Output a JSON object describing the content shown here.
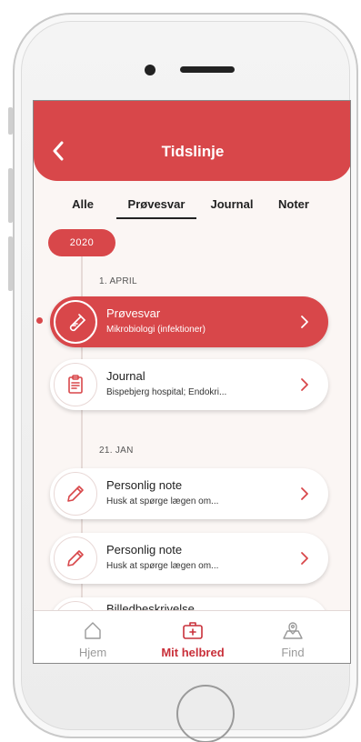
{
  "header": {
    "title": "Tidslinje"
  },
  "tabs": [
    {
      "label": "Alle",
      "active": false
    },
    {
      "label": "Prøvesvar",
      "active": true
    },
    {
      "label": "Journal",
      "active": false
    },
    {
      "label": "Noter",
      "active": false
    }
  ],
  "timeline": {
    "year": "2020",
    "dates": [
      "1. APRIL",
      "21. JAN"
    ],
    "entries": [
      {
        "title": "Prøvesvar",
        "subtitle": "Mikrobiologi (infektioner)",
        "icon": "test-tube-icon",
        "selected": true
      },
      {
        "title": "Journal",
        "subtitle": "Bispebjerg hospital; Endokri...",
        "icon": "clipboard-icon",
        "selected": false
      },
      {
        "title": "Personlig note",
        "subtitle": "Husk at spørge lægen om...",
        "icon": "pencil-icon",
        "selected": false
      },
      {
        "title": "Personlig note",
        "subtitle": "Husk at spørge lægen om...",
        "icon": "pencil-icon",
        "selected": false
      },
      {
        "title": "Billedbeskrivelse",
        "subtitle": "",
        "icon": "image-icon",
        "selected": false
      }
    ]
  },
  "tabbar": [
    {
      "label": "Hjem",
      "icon": "home-icon",
      "active": false
    },
    {
      "label": "Mit helbred",
      "icon": "medical-kit-icon",
      "active": true
    },
    {
      "label": "Find",
      "icon": "map-pin-icon",
      "active": false
    }
  ],
  "colors": {
    "accent": "#d8474a",
    "active_tab": "#c9303a",
    "background": "#fbf6f4"
  }
}
